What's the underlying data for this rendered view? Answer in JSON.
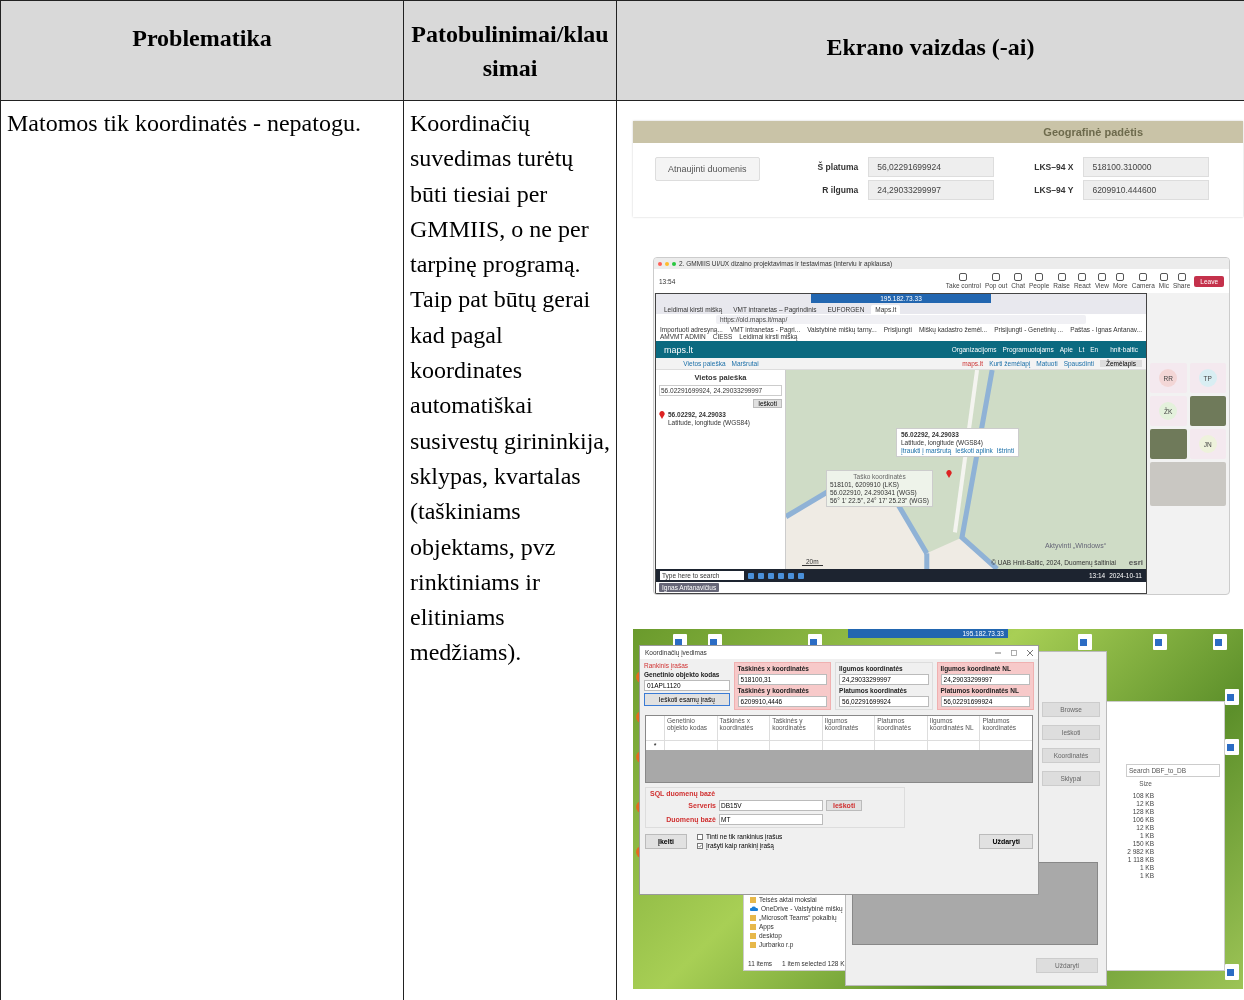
{
  "table": {
    "columns": [
      "Problematika",
      "Patobulinimai/klausimai",
      "Ekrano vaizdas (-ai)"
    ],
    "rows": [
      {
        "problem": "Matomos tik koordinatės - nepatogu.",
        "improvement": "Koordinačių suvedimas turėtų būti tiesiai per GMMIIS, o ne per tarpinę programą. Taip pat būtų gerai kad pagal koordinates automatiškai susivestų girininkija, sklypas, kvartalas (taškiniams objektams, pvz rinktiniams ir elitiniams medžiams).",
        "geo_panel": {
          "title": "Geografinė padėtis",
          "button": "Atnaujinti duomenis",
          "fields": [
            {
              "label": "Š platuma",
              "value": "56,02291699924"
            },
            {
              "label": "LKS–94 X",
              "value": "518100.310000"
            },
            {
              "label": "R ilguma",
              "value": "24,29033299997"
            },
            {
              "label": "LKS–94 Y",
              "value": "6209910.444600"
            }
          ]
        },
        "meeting": {
          "title": "2. GMMIIS UI/UX dizaino projektavimas ir testavimas (interviu ir apklausa)",
          "time": "13:54",
          "tools": [
            "Take control",
            "Pop out",
            "Chat",
            "People",
            "Raise",
            "React",
            "View",
            "More",
            "Camera",
            "Mic",
            "Share"
          ],
          "leave": "Leave",
          "remote_bar": "195.182.73.33",
          "browser_tabs": [
            {
              "label": "Leidimai kirsti mišką",
              "selected": false
            },
            {
              "label": "VMT intranetas – Pagrindinis",
              "selected": false
            },
            {
              "label": "EUFORGEN",
              "selected": false
            },
            {
              "label": "Maps.lt",
              "selected": true
            }
          ],
          "address": "https://old.maps.lt/map/",
          "bookmarks": [
            "Importuoti adresyną...",
            "VMT intranetas - Pagri...",
            "Valstybinė miškų tarny...",
            "Prisijungti",
            "Miškų kadastro žemėl...",
            "Prisijungti - Genetinių ...",
            "Paštas - Ignas Antanav...",
            "AMVMT ADMIN",
            "CIESS",
            "Leidimai kirsti mišką"
          ],
          "site": {
            "logo": "maps.lt",
            "nav": [
              "Organizacijoms",
              "Programuotojams",
              "Apie",
              "Lt",
              "En"
            ],
            "brand": "hnit·baltic",
            "subnav": [
              "Vietos paieška",
              "Maršrutai"
            ],
            "tools": [
              "maps.lt",
              "Kurti žemėlapį",
              "Matuoti",
              "Spausdinti"
            ],
            "layer": "Žemėlapis",
            "panel_title": "Vietos paieška",
            "search_value": "56.02291699924, 24.29033299997",
            "search_button": "Ieškoti",
            "result_title": "56.02292, 24.29033",
            "result_subtitle": "Latitude, longitude (WGS84)",
            "popup": {
              "title": "56.02292, 24.29033",
              "subtitle": "Latitude, longitude (WGS84)",
              "links": [
                "Įtraukti į maršrutą",
                "Ieškoti aplink",
                "Ištrinti"
              ]
            },
            "tooltip": {
              "title": "Taško koordinatės",
              "lines": [
                "518101, 6209910 (LKS)",
                "56.022910, 24.290341 (WGS)",
                "56° 1' 22.5\", 24° 17' 25.23\" (WGS)"
              ]
            },
            "activation": "Aktyvinti „Windows“",
            "scale": "20m",
            "copyright": "© UAB Hnit-Baltic, 2024, Duomenų šaltiniai",
            "esri": "esri"
          },
          "taskbar": {
            "search": "Type here to search",
            "time": "13:14",
            "date": "2024-10-11",
            "user": "Ignas Antanavičius"
          },
          "participants": [
            {
              "kind": "initials",
              "initials": "RR",
              "color": "#f3d6d6"
            },
            {
              "kind": "initials",
              "initials": "TP",
              "color": "#d9eef3"
            },
            {
              "kind": "initials",
              "initials": "ŽK",
              "color": "#e4f1dc"
            },
            {
              "kind": "video"
            },
            {
              "kind": "video"
            },
            {
              "kind": "initials",
              "initials": "JN",
              "color": "#eef2dc"
            }
          ]
        },
        "desktop": {
          "remote_bar": "195.182.73.33",
          "dialog": {
            "title": "Koordinačių įvedimas",
            "manual": "Rankinis įrašas",
            "code_label": "Genetinio objekto kodas",
            "code_value": "01APL1120",
            "find_button": "Ieškoti esamų įrašų",
            "groups": [
              {
                "highlight": true,
                "fields": [
                  {
                    "label": "Taškinės x koordinatės",
                    "value": "518100,31"
                  },
                  {
                    "label": "Taškinės y koordinatės",
                    "value": "6209910,4446"
                  }
                ]
              },
              {
                "highlight": false,
                "fields": [
                  {
                    "label": "Ilgumos koordinatės",
                    "value": "24,29033299997"
                  },
                  {
                    "label": "Platumos koordinatės",
                    "value": "56,02291699924"
                  }
                ]
              },
              {
                "highlight": true,
                "fields": [
                  {
                    "label": "Ilgumos koordinatė NL",
                    "value": "24,29033299997"
                  },
                  {
                    "label": "Platumos koordinatės NL",
                    "value": "56,02291699924"
                  }
                ]
              }
            ],
            "grid_columns": [
              "Genetinio objekto kodas",
              "Taškinės x koordinatės",
              "Taškinės y koordinatės",
              "Ilgumos koordinatės",
              "Platumos koordinatės",
              "Ilgumos koordinatės NL",
              "Platumos koordinatės"
            ],
            "new_row": "*",
            "sql": {
              "title": "SQL duomenų bazė",
              "server_label": "Serveris",
              "server": "DB15V",
              "search": "Ieškoti",
              "db_label": "Duomenų bazė",
              "db": "MT"
            },
            "checks": [
              {
                "label": "Tinti ne tik rankinius įrašus",
                "checked": false
              },
              {
                "label": "Įrašyti kaip rankinį įrašą",
                "checked": true
              }
            ],
            "upload": "Įkelti",
            "close": "Uždaryti"
          },
          "back_dialog": {
            "buttons": [
              "Browse",
              "Ieškoti",
              "Koordinatės",
              "Sklypai"
            ],
            "close": "Uždaryti"
          },
          "explorer": {
            "search": "Search DBF_to_DB",
            "size_header": "Size",
            "sizes": [
              "108 KB",
              "12 KB",
              "128 KB",
              "106 KB",
              "12 KB",
              "1 KB",
              "150 KB",
              "2 982 KB",
              "1 118 KB",
              "1 KB",
              "1 KB"
            ],
            "folders": [
              {
                "kind": "folder",
                "label": "Teisės aktai mokslai"
              },
              {
                "kind": "cloud",
                "label": "OneDrive - Valstybinė miškų"
              },
              {
                "kind": "folder",
                "label": "„Microsoft Teams“ pokalbių"
              },
              {
                "kind": "folder",
                "label": "Apps"
              },
              {
                "kind": "folder",
                "label": "desktop"
              },
              {
                "kind": "folder",
                "label": "Jurbarko r.p"
              }
            ],
            "status": [
              "11 items",
              "1 item selected 128 K"
            ]
          }
        }
      }
    ]
  }
}
